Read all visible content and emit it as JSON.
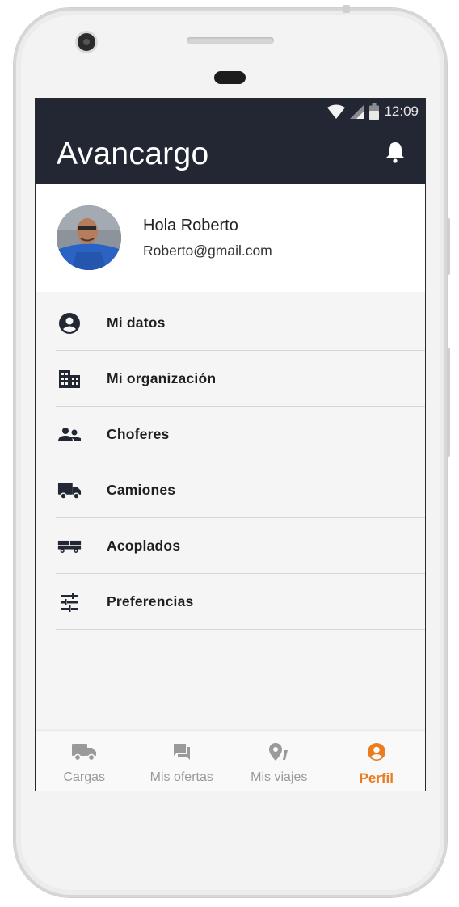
{
  "status_bar": {
    "time": "12:09"
  },
  "app_bar": {
    "title": "Avancargo"
  },
  "profile": {
    "greeting": "Hola Roberto",
    "email": "Roberto@gmail.com"
  },
  "menu": [
    {
      "label": "Mi datos",
      "icon": "account-circle-icon"
    },
    {
      "label": "Mi organización",
      "icon": "building-icon"
    },
    {
      "label": "Choferes",
      "icon": "people-icon"
    },
    {
      "label": "Camiones",
      "icon": "truck-icon"
    },
    {
      "label": "Acoplados",
      "icon": "trailer-icon"
    },
    {
      "label": "Preferencias",
      "icon": "sliders-icon"
    }
  ],
  "bottom_nav": [
    {
      "label": "Cargas",
      "icon": "truck-icon",
      "active": false
    },
    {
      "label": "Mis ofertas",
      "icon": "chat-icon",
      "active": false
    },
    {
      "label": "Mis viajes",
      "icon": "map-pin-icon",
      "active": false
    },
    {
      "label": "Perfil",
      "icon": "account-circle-icon",
      "active": true
    }
  ],
  "colors": {
    "app_bar": "#232733",
    "accent": "#ea7b1e",
    "inactive": "#9a9a9a"
  }
}
